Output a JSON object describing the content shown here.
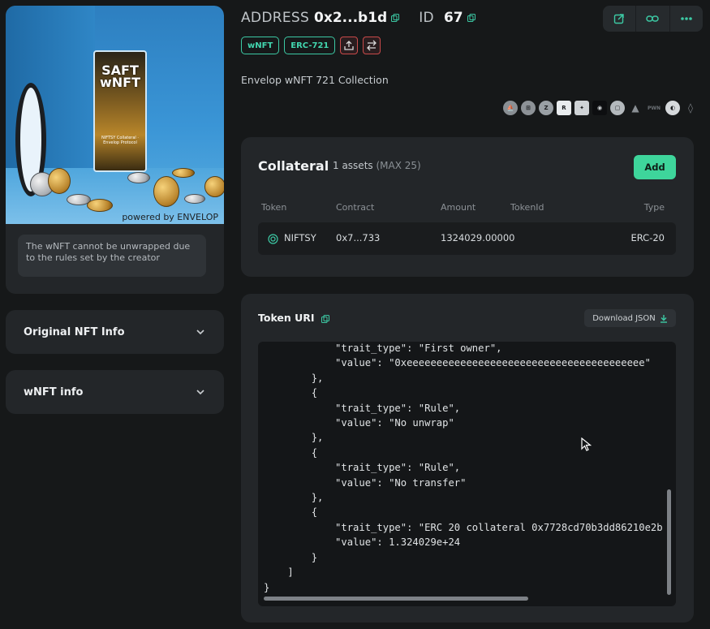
{
  "nft": {
    "image_box_title": "SAFT wNFT",
    "image_box_subtitle": "NIFTSY Collateral · Envelop Protocol",
    "image_caption": "powered by ENVELOP",
    "unwrap_note": "The wNFT cannot be unwrapped due to the rules set by the creator"
  },
  "accordions": [
    {
      "label": "Original NFT Info"
    },
    {
      "label": "wNFT info"
    }
  ],
  "header": {
    "address_label": "ADDRESS",
    "address_value": "0x2...b1d",
    "id_label": "ID",
    "id_value": "67"
  },
  "toolbar": {
    "icons": [
      "external-link-icon",
      "link-icon",
      "more-icon"
    ]
  },
  "tags": [
    "wNFT",
    "ERC-721"
  ],
  "collection_name": "Envelop wNFT 721 Collection",
  "chains": [
    "chain-1",
    "chain-2",
    "chain-3",
    "chain-4",
    "chain-5",
    "chain-6",
    "chain-7",
    "chain-8",
    "chain-9",
    "chain-10",
    "chain-11"
  ],
  "chain_text": "PWN",
  "collateral": {
    "title": "Collateral",
    "count": "1 assets",
    "max": "(MAX 25)",
    "add_label": "Add",
    "columns": {
      "token": "Token",
      "contract": "Contract",
      "amount": "Amount",
      "tokenid": "TokenId",
      "type": "Type"
    },
    "rows": [
      {
        "token": "NIFTSY",
        "contract": "0x7...733",
        "amount": "1324029.00000",
        "tokenid": "",
        "type": "ERC-20"
      }
    ]
  },
  "token_uri": {
    "title": "Token URI",
    "download_label": "Download JSON",
    "code": "            \"trait_type\": \"First owner\",\n            \"value\": \"0xeeeeeeeeeeeeeeeeeeeeeeeeeeeeeeeeeeeeeeee\"\n        },\n        {\n            \"trait_type\": \"Rule\",\n            \"value\": \"No unwrap\"\n        },\n        {\n            \"trait_type\": \"Rule\",\n            \"value\": \"No transfer\"\n        },\n        {\n            \"trait_type\": \"ERC 20 collateral 0x7728cd70b3dd86210e2b\n            \"value\": 1.324029e+24\n        }\n    ]\n}"
  }
}
